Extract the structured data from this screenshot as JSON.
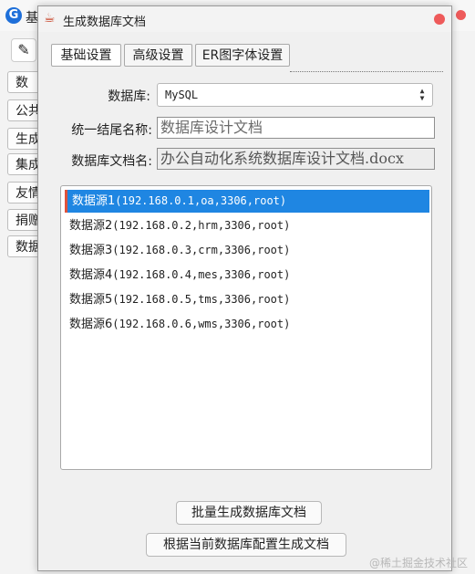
{
  "background_window": {
    "title": "基",
    "menu_items": [
      "数",
      "公共",
      "生成",
      "集成",
      "友情",
      "捐赠",
      "数据"
    ]
  },
  "dialog": {
    "title": "生成数据库文档",
    "tabs": [
      "基础设置",
      "高级设置",
      "ER图字体设置"
    ],
    "active_tab": "基础设置",
    "database_label": "数据库:",
    "database_value": "MySQL",
    "suffix_label": "统一结尾名称:",
    "suffix_placeholder": "数据库设计文档",
    "docname_label": "数据库文档名:",
    "docname_value": "办公自动化系统数据库设计文档.docx",
    "datasources": [
      {
        "name": "数据源1",
        "detail": "(192.168.0.1,oa,3306,root)",
        "selected": true
      },
      {
        "name": "数据源2",
        "detail": "(192.168.0.2,hrm,3306,root)",
        "selected": false
      },
      {
        "name": "数据源3",
        "detail": "(192.168.0.3,crm,3306,root)",
        "selected": false
      },
      {
        "name": "数据源4",
        "detail": "(192.168.0.4,mes,3306,root)",
        "selected": false
      },
      {
        "name": "数据源5",
        "detail": "(192.168.0.5,tms,3306,root)",
        "selected": false
      },
      {
        "name": "数据源6",
        "detail": "(192.168.0.6,wms,3306,root)",
        "selected": false
      }
    ],
    "batch_button": "批量生成数据库文档",
    "current_button": "根据当前数据库配置生成文档"
  },
  "icons": {
    "app": "g-logo-icon",
    "dialog": "coffee-cup-icon",
    "close": "close-dot-icon",
    "select": "updown-arrows-icon"
  },
  "colors": {
    "selection": "#1f86e2",
    "selection_marker": "#e0533b",
    "close_button": "#ee5a5a"
  },
  "watermark": "@稀土掘金技术社区"
}
